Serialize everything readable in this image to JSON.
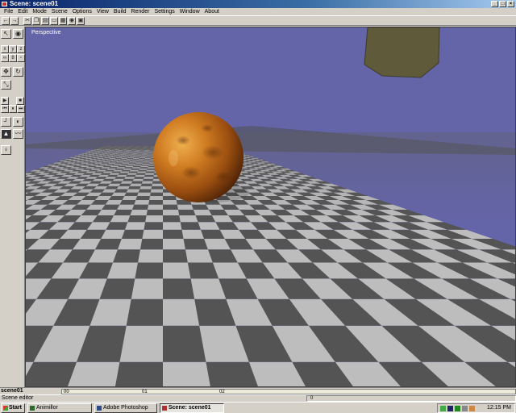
{
  "window": {
    "title": "Scene: scene01"
  },
  "menu": [
    "File",
    "Edit",
    "Mode",
    "Scene",
    "Options",
    "View",
    "Build",
    "Render",
    "Settings",
    "Window",
    "About"
  ],
  "viewport": {
    "label": "Perspective",
    "sky_color": "#6464a8"
  },
  "timeline": {
    "scene_name": "scene01",
    "ticks": [
      "00",
      "01",
      "02"
    ]
  },
  "status": {
    "text": "Scene editor",
    "frame": "0"
  },
  "taskbar": {
    "start_label": "Start",
    "tasks": [
      "Animillor",
      "Adobe Photoshop",
      "Scene: scene01"
    ],
    "clock": "12:15 PM"
  }
}
